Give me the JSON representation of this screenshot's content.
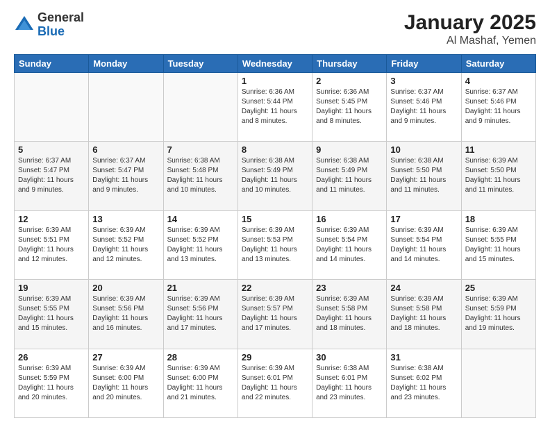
{
  "header": {
    "logo_general": "General",
    "logo_blue": "Blue",
    "month_title": "January 2025",
    "location": "Al Mashaf, Yemen"
  },
  "days_of_week": [
    "Sunday",
    "Monday",
    "Tuesday",
    "Wednesday",
    "Thursday",
    "Friday",
    "Saturday"
  ],
  "weeks": [
    [
      {
        "day": "",
        "info": ""
      },
      {
        "day": "",
        "info": ""
      },
      {
        "day": "",
        "info": ""
      },
      {
        "day": "1",
        "info": "Sunrise: 6:36 AM\nSunset: 5:44 PM\nDaylight: 11 hours and 8 minutes."
      },
      {
        "day": "2",
        "info": "Sunrise: 6:36 AM\nSunset: 5:45 PM\nDaylight: 11 hours and 8 minutes."
      },
      {
        "day": "3",
        "info": "Sunrise: 6:37 AM\nSunset: 5:46 PM\nDaylight: 11 hours and 9 minutes."
      },
      {
        "day": "4",
        "info": "Sunrise: 6:37 AM\nSunset: 5:46 PM\nDaylight: 11 hours and 9 minutes."
      }
    ],
    [
      {
        "day": "5",
        "info": "Sunrise: 6:37 AM\nSunset: 5:47 PM\nDaylight: 11 hours and 9 minutes."
      },
      {
        "day": "6",
        "info": "Sunrise: 6:37 AM\nSunset: 5:47 PM\nDaylight: 11 hours and 9 minutes."
      },
      {
        "day": "7",
        "info": "Sunrise: 6:38 AM\nSunset: 5:48 PM\nDaylight: 11 hours and 10 minutes."
      },
      {
        "day": "8",
        "info": "Sunrise: 6:38 AM\nSunset: 5:49 PM\nDaylight: 11 hours and 10 minutes."
      },
      {
        "day": "9",
        "info": "Sunrise: 6:38 AM\nSunset: 5:49 PM\nDaylight: 11 hours and 11 minutes."
      },
      {
        "day": "10",
        "info": "Sunrise: 6:38 AM\nSunset: 5:50 PM\nDaylight: 11 hours and 11 minutes."
      },
      {
        "day": "11",
        "info": "Sunrise: 6:39 AM\nSunset: 5:50 PM\nDaylight: 11 hours and 11 minutes."
      }
    ],
    [
      {
        "day": "12",
        "info": "Sunrise: 6:39 AM\nSunset: 5:51 PM\nDaylight: 11 hours and 12 minutes."
      },
      {
        "day": "13",
        "info": "Sunrise: 6:39 AM\nSunset: 5:52 PM\nDaylight: 11 hours and 12 minutes."
      },
      {
        "day": "14",
        "info": "Sunrise: 6:39 AM\nSunset: 5:52 PM\nDaylight: 11 hours and 13 minutes."
      },
      {
        "day": "15",
        "info": "Sunrise: 6:39 AM\nSunset: 5:53 PM\nDaylight: 11 hours and 13 minutes."
      },
      {
        "day": "16",
        "info": "Sunrise: 6:39 AM\nSunset: 5:54 PM\nDaylight: 11 hours and 14 minutes."
      },
      {
        "day": "17",
        "info": "Sunrise: 6:39 AM\nSunset: 5:54 PM\nDaylight: 11 hours and 14 minutes."
      },
      {
        "day": "18",
        "info": "Sunrise: 6:39 AM\nSunset: 5:55 PM\nDaylight: 11 hours and 15 minutes."
      }
    ],
    [
      {
        "day": "19",
        "info": "Sunrise: 6:39 AM\nSunset: 5:55 PM\nDaylight: 11 hours and 15 minutes."
      },
      {
        "day": "20",
        "info": "Sunrise: 6:39 AM\nSunset: 5:56 PM\nDaylight: 11 hours and 16 minutes."
      },
      {
        "day": "21",
        "info": "Sunrise: 6:39 AM\nSunset: 5:56 PM\nDaylight: 11 hours and 17 minutes."
      },
      {
        "day": "22",
        "info": "Sunrise: 6:39 AM\nSunset: 5:57 PM\nDaylight: 11 hours and 17 minutes."
      },
      {
        "day": "23",
        "info": "Sunrise: 6:39 AM\nSunset: 5:58 PM\nDaylight: 11 hours and 18 minutes."
      },
      {
        "day": "24",
        "info": "Sunrise: 6:39 AM\nSunset: 5:58 PM\nDaylight: 11 hours and 18 minutes."
      },
      {
        "day": "25",
        "info": "Sunrise: 6:39 AM\nSunset: 5:59 PM\nDaylight: 11 hours and 19 minutes."
      }
    ],
    [
      {
        "day": "26",
        "info": "Sunrise: 6:39 AM\nSunset: 5:59 PM\nDaylight: 11 hours and 20 minutes."
      },
      {
        "day": "27",
        "info": "Sunrise: 6:39 AM\nSunset: 6:00 PM\nDaylight: 11 hours and 20 minutes."
      },
      {
        "day": "28",
        "info": "Sunrise: 6:39 AM\nSunset: 6:00 PM\nDaylight: 11 hours and 21 minutes."
      },
      {
        "day": "29",
        "info": "Sunrise: 6:39 AM\nSunset: 6:01 PM\nDaylight: 11 hours and 22 minutes."
      },
      {
        "day": "30",
        "info": "Sunrise: 6:38 AM\nSunset: 6:01 PM\nDaylight: 11 hours and 23 minutes."
      },
      {
        "day": "31",
        "info": "Sunrise: 6:38 AM\nSunset: 6:02 PM\nDaylight: 11 hours and 23 minutes."
      },
      {
        "day": "",
        "info": ""
      }
    ]
  ]
}
